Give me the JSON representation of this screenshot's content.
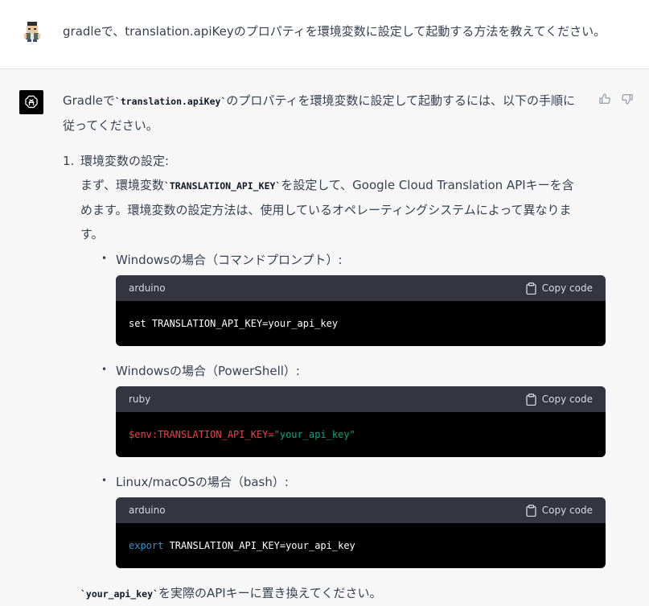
{
  "user_message": {
    "text": "gradleで、translation.apiKeyのプロパティを環境変数に設定して起動する方法を教えてください。"
  },
  "assistant": {
    "intro_before": "Gradleで",
    "intro_code": "`translation.apiKey`",
    "intro_after": "のプロパティを環境変数に設定して起動するには、以下の手順に従ってください。",
    "step1": {
      "number": "1.",
      "title": "環境変数の設定:",
      "desc_before": "まず、環境変数",
      "desc_code": "`TRANSLATION_API_KEY`",
      "desc_after": "を設定して、Google Cloud Translation APIキーを含めます。環境変数の設定方法は、使用しているオペレーティングシステムによって異なります。"
    },
    "bullets": [
      {
        "label": "Windowsの場合（コマンドプロンプト）:",
        "lang": "arduino",
        "copy": "Copy code",
        "code_a": "set TRANSLATION_API_KEY=your_api_key",
        "code_b": "",
        "code_c": ""
      },
      {
        "label": "Windowsの場合（PowerShell）:",
        "lang": "ruby",
        "copy": "Copy code",
        "code_a": "$env:TRANSLATION_API_KEY=",
        "code_b": "\"your_api_key\"",
        "code_c": ""
      },
      {
        "label": "Linux/macOSの場合（bash）:",
        "lang": "arduino",
        "copy": "Copy code",
        "code_a": "export",
        "code_b": " TRANSLATION_API_KEY=your_api_key",
        "code_c": ""
      }
    ],
    "closing_code": "`your_api_key`",
    "closing_after": "を実際のAPIキーに置き換えてください。"
  },
  "colors": {
    "user_bg": "#ffffff",
    "assistant_bg": "#f7f7f8",
    "code_header": "#343541",
    "code_body": "#000000",
    "token_variable": "#ef4146",
    "token_string": "#00a67d",
    "token_keyword": "#2e95d3"
  },
  "icons": [
    "user-avatar-icon",
    "chatgpt-logo-icon",
    "thumbs-up-icon",
    "thumbs-down-icon",
    "clipboard-icon"
  ]
}
